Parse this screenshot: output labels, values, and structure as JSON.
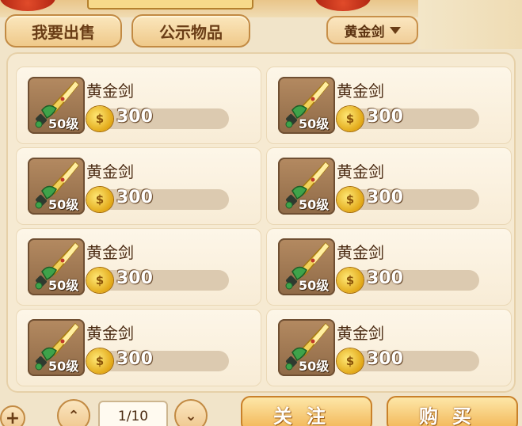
{
  "header": {
    "tabs": [
      {
        "label": "我要出售"
      },
      {
        "label": "公示物品"
      }
    ],
    "filter": {
      "selected": "黄金剑"
    }
  },
  "items": [
    {
      "name": "黄金剑",
      "level": "50级",
      "price": "300",
      "icon": "golden-sword-icon"
    },
    {
      "name": "黄金剑",
      "level": "50级",
      "price": "300",
      "icon": "golden-sword-icon"
    },
    {
      "name": "黄金剑",
      "level": "50级",
      "price": "300",
      "icon": "golden-sword-icon"
    },
    {
      "name": "黄金剑",
      "level": "50级",
      "price": "300",
      "icon": "golden-sword-icon"
    },
    {
      "name": "黄金剑",
      "level": "50级",
      "price": "300",
      "icon": "golden-sword-icon"
    },
    {
      "name": "黄金剑",
      "level": "50级",
      "price": "300",
      "icon": "golden-sword-icon"
    },
    {
      "name": "黄金剑",
      "level": "50级",
      "price": "300",
      "icon": "golden-sword-icon"
    },
    {
      "name": "黄金剑",
      "level": "50级",
      "price": "300",
      "icon": "golden-sword-icon"
    }
  ],
  "pagination": {
    "page": "1/10"
  },
  "actions": {
    "follow": "关注",
    "buy": "购买"
  }
}
